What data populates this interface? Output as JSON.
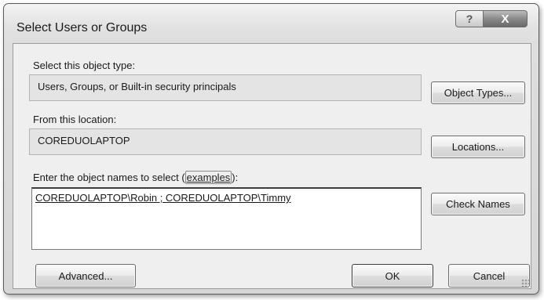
{
  "window": {
    "title": "Select Users or Groups",
    "help_label": "?",
    "close_label": "X"
  },
  "object_type": {
    "label": "Select this object type:",
    "value": "Users, Groups, or Built-in security principals",
    "button": "Object Types..."
  },
  "location": {
    "label": "From this location:",
    "value": "COREDUOLAPTOP",
    "button": "Locations..."
  },
  "object_names": {
    "label_prefix": "Enter the object names to select (",
    "label_link": "examples",
    "label_suffix": "):",
    "value": "COREDUOLAPTOP\\Robin ; COREDUOLAPTOP\\Timmy",
    "button": "Check Names"
  },
  "footer": {
    "advanced": "Advanced...",
    "ok": "OK",
    "cancel": "Cancel"
  }
}
